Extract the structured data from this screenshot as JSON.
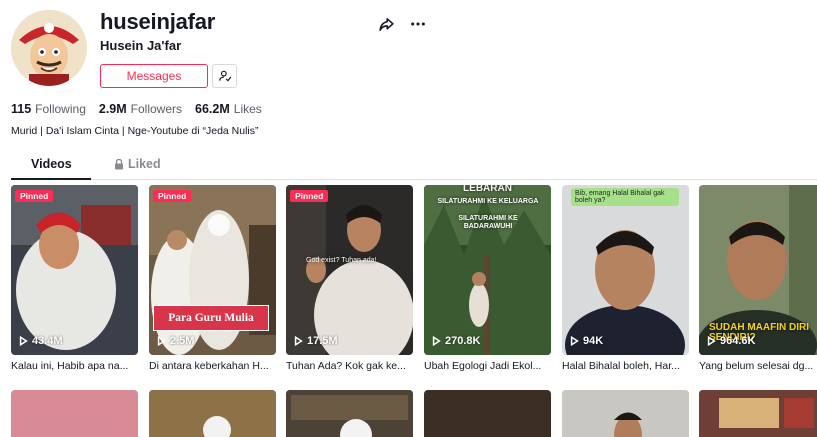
{
  "profile": {
    "username": "huseinjafar",
    "nickname": "Husein Ja'far",
    "messages_label": "Messages",
    "bio": "Murid | Da'i Islam Cinta | Nge-Youtube di “Jeda Nulis”"
  },
  "stats": [
    {
      "value": "115",
      "label": "Following"
    },
    {
      "value": "2.9M",
      "label": "Followers"
    },
    {
      "value": "66.2M",
      "label": "Likes"
    }
  ],
  "tabs": {
    "videos": "Videos",
    "liked": "Liked"
  },
  "pinned_label": "Pinned",
  "videos": [
    {
      "views": "43.4M",
      "caption": "Kalau ini, Habib apa na...",
      "pinned": true
    },
    {
      "views": "2.5M",
      "caption": "Di antara keberkahan H...",
      "pinned": true,
      "overlay": "Para Guru Mulia"
    },
    {
      "views": "17.5M",
      "caption": "Tuhan Ada? Kok gak ke...",
      "pinned": true,
      "overlay": "God exist? Tuhan ada!"
    },
    {
      "views": "270.8K",
      "caption": "Ubah Egologi Jadi Ekol...",
      "pinned": false,
      "overlay_top": "LEBARAN",
      "overlay_1": "SILATURAHMI KE KELUARGA",
      "overlay_2": "SILATURAHMI KE BADARAWUHI"
    },
    {
      "views": "94K",
      "caption": "Halal Bihalal boleh, Har...",
      "pinned": false,
      "bubble": "Bib, emang Halal Bihalal gak boleh ya?"
    },
    {
      "views": "964.6K",
      "caption": "Yang belum selesai dg...",
      "pinned": false,
      "overlay": "SUDAH MAAFIN DIRI SENDIRI?"
    }
  ],
  "colors": {
    "accent": "#fe2c55",
    "text": "#161823",
    "muted": "#8a8b91"
  }
}
